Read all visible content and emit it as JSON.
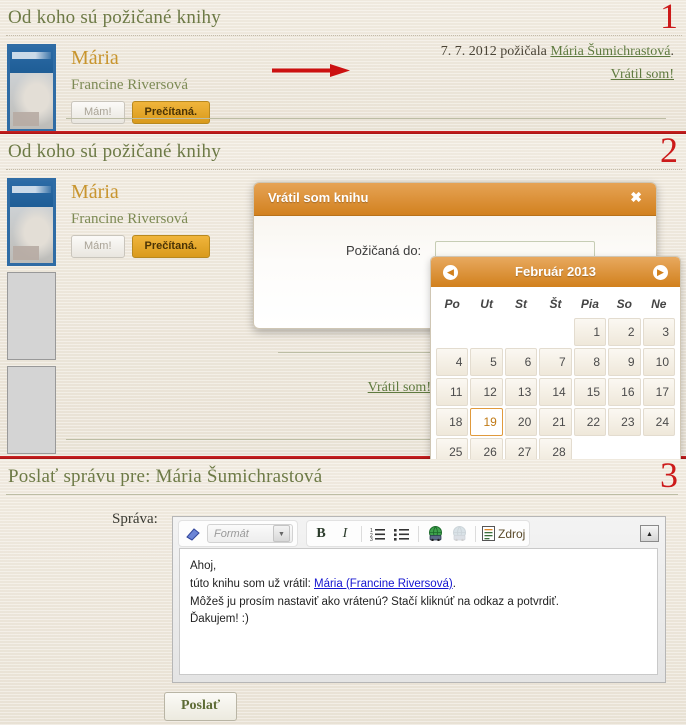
{
  "panels": [
    {
      "number": "1",
      "section_title": "Od koho sú požičané knihy",
      "book": {
        "title": "Mária",
        "author": "Francine Riversová",
        "have_button": "Mám!",
        "read_button": "Prečítaná."
      },
      "lend_line": {
        "date": "7. 7. 2012",
        "verb": "požičala",
        "lender": "Mária Šumichrastová",
        "period": "."
      },
      "return_link": "Vrátil som!"
    },
    {
      "number": "2",
      "section_title": "Od koho sú požičané knihy",
      "book": {
        "title": "Mária",
        "author": "Francine Riversová",
        "have_button": "Mám!",
        "read_button": "Prečítaná."
      },
      "return_link": "Vrátil som!",
      "modal": {
        "title": "Vrátil som knihu",
        "close": "✖",
        "field_label": "Požičaná do:",
        "field_value": "",
        "field_placeholder": ""
      },
      "datepicker": {
        "month_year": "Február 2013",
        "prev": "◀",
        "next": "▶",
        "weekdays": [
          "Po",
          "Ut",
          "St",
          "Št",
          "Pia",
          "So",
          "Ne"
        ],
        "weeks": [
          [
            "",
            "",
            "",
            "",
            "1",
            "2",
            "3"
          ],
          [
            "4",
            "5",
            "6",
            "7",
            "8",
            "9",
            "10"
          ],
          [
            "11",
            "12",
            "13",
            "14",
            "15",
            "16",
            "17"
          ],
          [
            "18",
            "19",
            "20",
            "21",
            "22",
            "23",
            "24"
          ],
          [
            "25",
            "26",
            "27",
            "28",
            "",
            "",
            ""
          ]
        ],
        "today": "19"
      }
    },
    {
      "number": "3",
      "section_title": "Poslať správu pre: Mária Šumichrastová",
      "message_label": "Správa:",
      "editor": {
        "format_label": "Formát",
        "bold": "B",
        "italic": "I",
        "source_label": "Zdroj",
        "body_lines": [
          "Ahoj,",
          "túto knihu som už vrátil: ",
          "Môžeš ju prosím nastaviť ako vrátenú? Stačí kliknúť na odkaz a potvrdiť.",
          "Ďakujem! :)"
        ],
        "body_link": "Mária (Francine Riversová)",
        "body_line2_tail": "."
      },
      "send_button": "Poslať"
    }
  ],
  "colors": {
    "accent_orange": "#d2811f",
    "panel_number_red": "#cc1a1a",
    "section_title_green": "#6d7a46",
    "link_green": "#5e7a3f",
    "book_title_gold": "#c8952e",
    "background": "#f0eade"
  }
}
